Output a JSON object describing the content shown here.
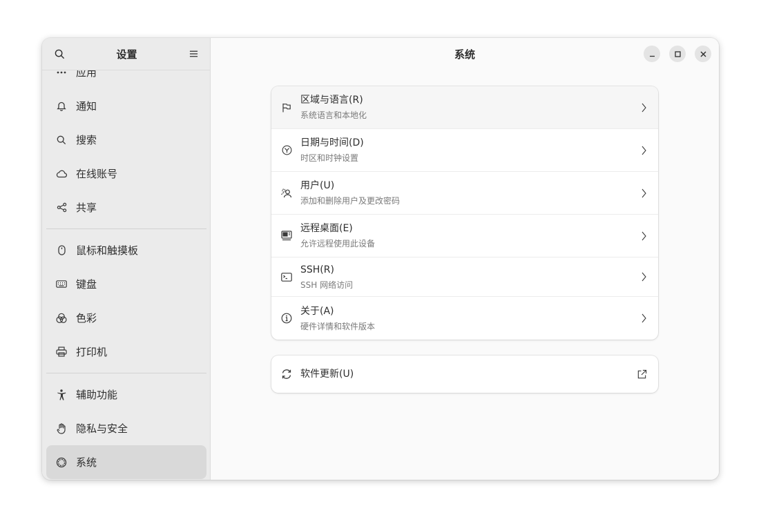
{
  "sidebar": {
    "title": "设置",
    "items": [
      {
        "label": "应用",
        "icon": "more-dots-icon"
      },
      {
        "label": "通知",
        "icon": "bell-icon"
      },
      {
        "label": "搜索",
        "icon": "search-icon"
      },
      {
        "label": "在线账号",
        "icon": "cloud-icon"
      },
      {
        "label": "共享",
        "icon": "share-icon"
      },
      {
        "label": "鼠标和触摸板",
        "icon": "mouse-icon"
      },
      {
        "label": "键盘",
        "icon": "keyboard-icon"
      },
      {
        "label": "色彩",
        "icon": "color-icon"
      },
      {
        "label": "打印机",
        "icon": "printer-icon"
      },
      {
        "label": "辅助功能",
        "icon": "accessibility-icon"
      },
      {
        "label": "隐私与安全",
        "icon": "hand-icon"
      },
      {
        "label": "系统",
        "icon": "gear-icon",
        "active": true
      }
    ]
  },
  "main": {
    "title": "系统",
    "rows": [
      {
        "title": "区域与语言(R)",
        "subtitle": "系统语言和本地化",
        "icon": "flag-icon"
      },
      {
        "title": "日期与时间(D)",
        "subtitle": "时区和时钟设置",
        "icon": "clock-icon"
      },
      {
        "title": "用户(U)",
        "subtitle": "添加和删除用户及更改密码",
        "icon": "users-icon"
      },
      {
        "title": "远程桌面(E)",
        "subtitle": "允许远程使用此设备",
        "icon": "remote-desktop-icon"
      },
      {
        "title": "SSH(R)",
        "subtitle": "SSH 网络访问",
        "icon": "terminal-icon"
      },
      {
        "title": "关于(A)",
        "subtitle": "硬件详情和软件版本",
        "icon": "info-icon"
      }
    ],
    "update": {
      "title": "软件更新(U)",
      "icon": "refresh-icon"
    }
  }
}
